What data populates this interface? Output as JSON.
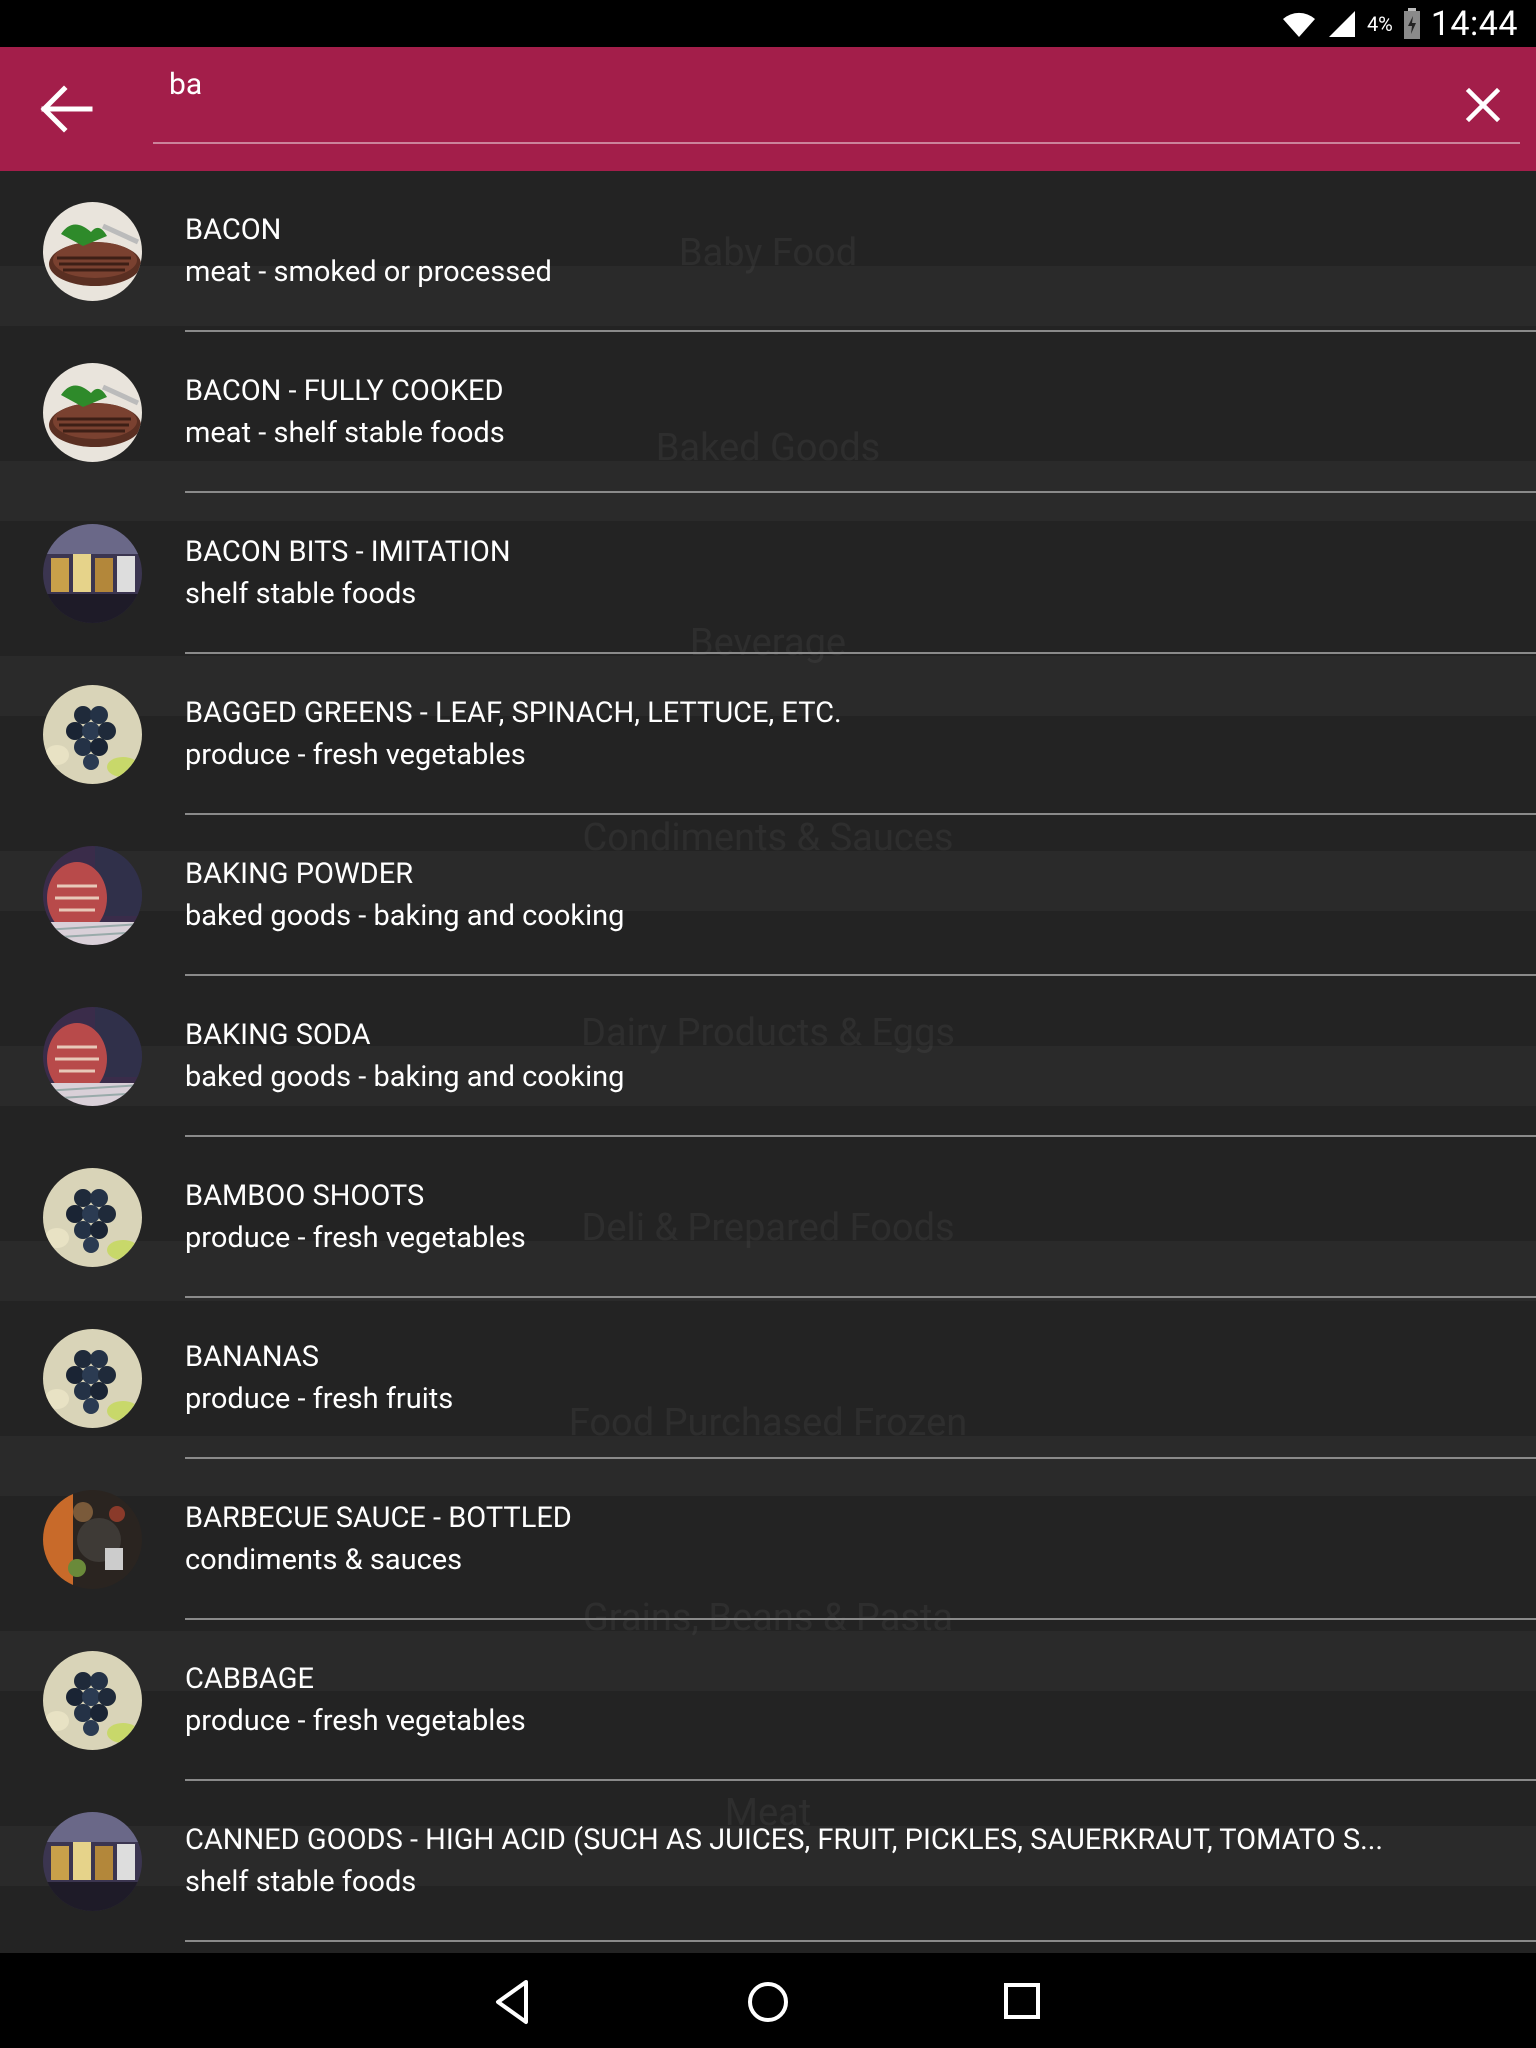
{
  "status_bar": {
    "battery_percent": "4%",
    "time": "14:44"
  },
  "toolbar": {
    "search_value": "ba",
    "background_color": "#a31e4a"
  },
  "background_categories": [
    "Baby Food",
    "Baked Goods",
    "Beverage",
    "Condiments & Sauces",
    "Dairy Products & Eggs",
    "Deli & Prepared Foods",
    "Food Purchased Frozen",
    "Grains, Beans & Pasta",
    "Meat"
  ],
  "results": [
    {
      "title": "BACON",
      "subtitle": "meat - smoked or processed",
      "icon": "steak-thumbnail-icon"
    },
    {
      "title": "BACON - FULLY COOKED",
      "subtitle": "meat - shelf stable foods",
      "icon": "steak-thumbnail-icon"
    },
    {
      "title": "BACON BITS - IMITATION",
      "subtitle": "shelf stable foods",
      "icon": "jars-thumbnail-icon"
    },
    {
      "title": "BAGGED GREENS - LEAF, SPINACH, LETTUCE, ETC.",
      "subtitle": "produce - fresh vegetables",
      "icon": "grapes-thumbnail-icon"
    },
    {
      "title": "BAKING POWDER",
      "subtitle": "baked goods - baking and cooking",
      "icon": "bread-thumbnail-icon"
    },
    {
      "title": "BAKING SODA",
      "subtitle": "baked goods - baking and cooking",
      "icon": "bread-thumbnail-icon"
    },
    {
      "title": "BAMBOO SHOOTS",
      "subtitle": "produce - fresh vegetables",
      "icon": "grapes-thumbnail-icon"
    },
    {
      "title": "BANANAS",
      "subtitle": "produce - fresh fruits",
      "icon": "grapes-thumbnail-icon"
    },
    {
      "title": "BARBECUE SAUCE - BOTTLED",
      "subtitle": "condiments & sauces",
      "icon": "spices-thumbnail-icon"
    },
    {
      "title": "CABBAGE",
      "subtitle": "produce - fresh vegetables",
      "icon": "grapes-thumbnail-icon"
    },
    {
      "title": "CANNED GOODS - HIGH ACID (SUCH AS JUICES, FRUIT, PICKLES, SAUERKRAUT, TOMATO S...",
      "subtitle": "shelf stable foods",
      "icon": "jars-thumbnail-icon"
    }
  ]
}
